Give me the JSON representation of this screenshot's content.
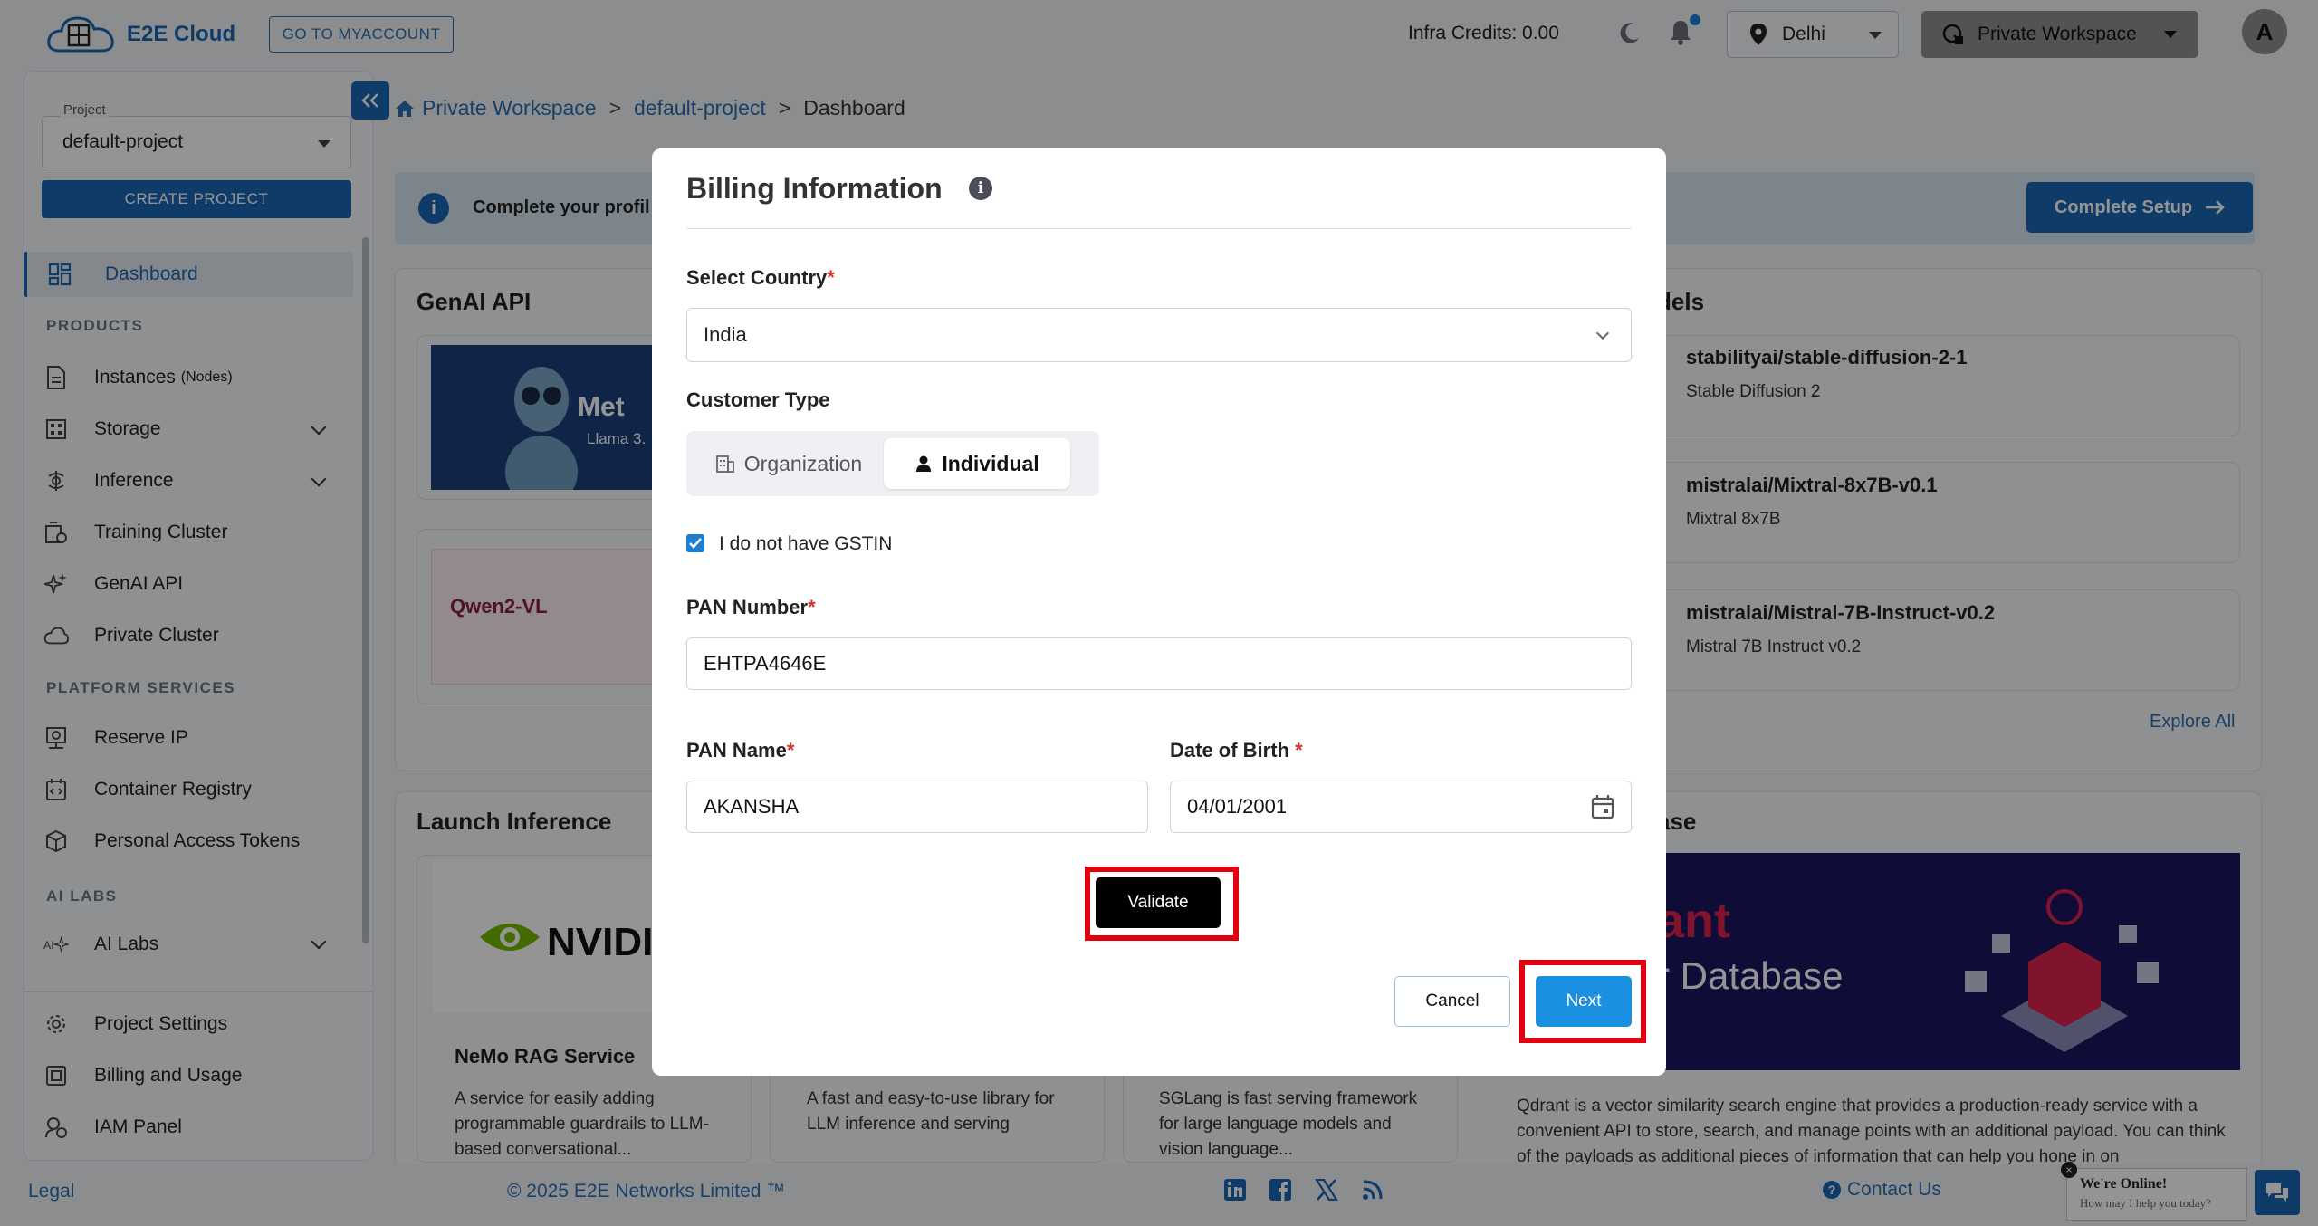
{
  "topbar": {
    "brand": "E2E Cloud",
    "myaccount_label": "GO TO MYACCOUNT",
    "infra_credits": "Infra Credits:  0.00",
    "region": "Delhi",
    "workspace": "Private Workspace",
    "avatar_letter": "A"
  },
  "sidebar": {
    "project_label": "Project",
    "project_value": "default-project",
    "create_project": "CREATE PROJECT",
    "dashboard": "Dashboard",
    "section_products": "PRODUCTS",
    "instances": "Instances",
    "instances_suffix": "(Nodes)",
    "storage": "Storage",
    "inference": "Inference",
    "training_cluster": "Training Cluster",
    "genai_api": "GenAI API",
    "private_cluster": "Private Cluster",
    "section_platform": "PLATFORM SERVICES",
    "reserve_ip": "Reserve IP",
    "container_registry": "Container Registry",
    "personal_access_tokens": "Personal Access Tokens",
    "section_ailabs": "AI LABS",
    "ai_labs": "AI Labs",
    "project_settings": "Project Settings",
    "billing_usage": "Billing and Usage",
    "iam_panel": "IAM Panel"
  },
  "breadcrumb": {
    "root": "Private Workspace",
    "project": "default-project",
    "current": "Dashboard",
    "sep": ">"
  },
  "banner": {
    "text": "Complete your profil",
    "button": "Complete Setup"
  },
  "cards": {
    "genai_title": "GenAI API",
    "meta_text": "Met",
    "llama_text": "Llama 3.",
    "qwen_title": "Qwen2-VL",
    "models_title": "dels",
    "models": [
      {
        "name": "stabilityai/stable-diffusion-2-1",
        "sub": "Stable Diffusion 2"
      },
      {
        "name": "mistralai/Mixtral-8x7B-v0.1",
        "sub": "Mixtral 8x7B"
      },
      {
        "name": "mistralai/Mistral-7B-Instruct-v0.2",
        "sub": "Mistral 7B Instruct v0.2"
      }
    ],
    "explore_all": "Explore All",
    "launch_title": "Launch Inference",
    "nvidia_text": "NVIDI",
    "nemo_title": "NeMo RAG Service",
    "nemo_desc": "A service for easily adding programmable guardrails to LLM-based conversational...",
    "vllm_desc": "A fast and easy-to-use library for LLM inference and serving",
    "sglang_desc": "SGLang is fast serving framework for large language models and vision language...",
    "vector_title": "ase",
    "qdrant_brand": "ant",
    "qdrant_sub": "r Database",
    "qdrant_desc": "Qdrant is a vector similarity search engine that provides a production-ready service with a convenient API to store, search, and manage points with an additional payload. You can think of the payloads as additional pieces of information that can help you hone in on"
  },
  "footer": {
    "legal": "Legal",
    "copyright": "© 2025 E2E Networks Limited ™",
    "contact": "Contact Us",
    "chat_title": "We're Online!",
    "chat_sub": "How may I help you today?"
  },
  "modal": {
    "title": "Billing Information",
    "country_label": "Select Country",
    "country_value": "India",
    "customer_type_label": "Customer Type",
    "opt_org": "Organization",
    "opt_individual": "Individual",
    "no_gstin": "I do not have GSTIN",
    "pan_number_label": "PAN Number",
    "pan_number_value": "EHTPA4646E",
    "pan_name_label": "PAN Name",
    "pan_name_value": "AKANSHA",
    "dob_label": "Date of Birth ",
    "dob_value": "04/01/2001",
    "req_mark": "*",
    "validate": "Validate",
    "cancel": "Cancel",
    "next": "Next"
  },
  "colors": {
    "brand": "#1b66b3",
    "next": "#1b8fe0",
    "highlight": "#e3000f"
  }
}
